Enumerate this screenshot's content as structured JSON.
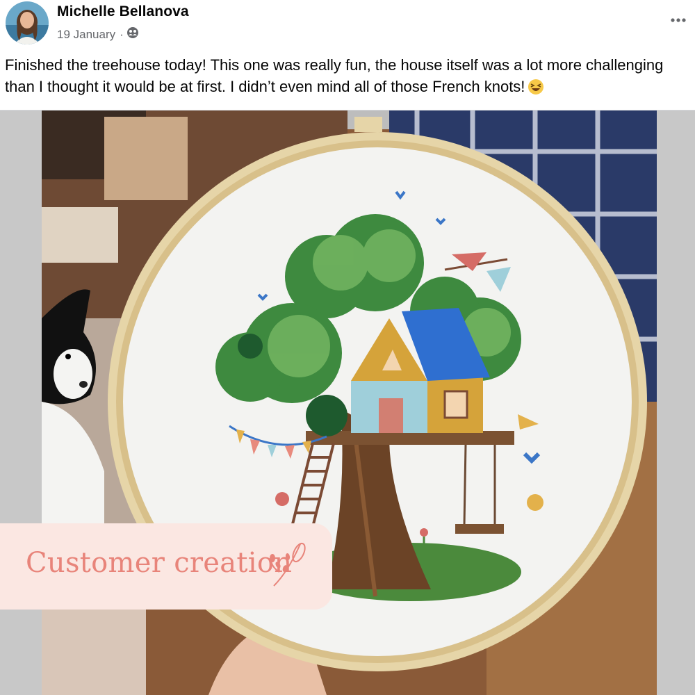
{
  "post": {
    "author": "Michelle Bellanova",
    "date": "19 January",
    "separator": "·",
    "audience_icon": "friends-icon",
    "more_icon": "more-options-icon",
    "text": "Finished the treehouse today! This one was really fun, the house itself was a lot more challenging than I thought it would be at first. I didn’t even mind all of those French knots!",
    "emoji": "laughing-face-emoji"
  },
  "photo": {
    "subject": "embroidery-hoop-treehouse-photo"
  },
  "badge": {
    "label": "Customer creation",
    "icon": "flower-sprig-icon"
  },
  "colors": {
    "text_primary": "#050505",
    "text_secondary": "#65676b",
    "badge_background": "#fbe7e2",
    "badge_text": "#e8847a"
  }
}
